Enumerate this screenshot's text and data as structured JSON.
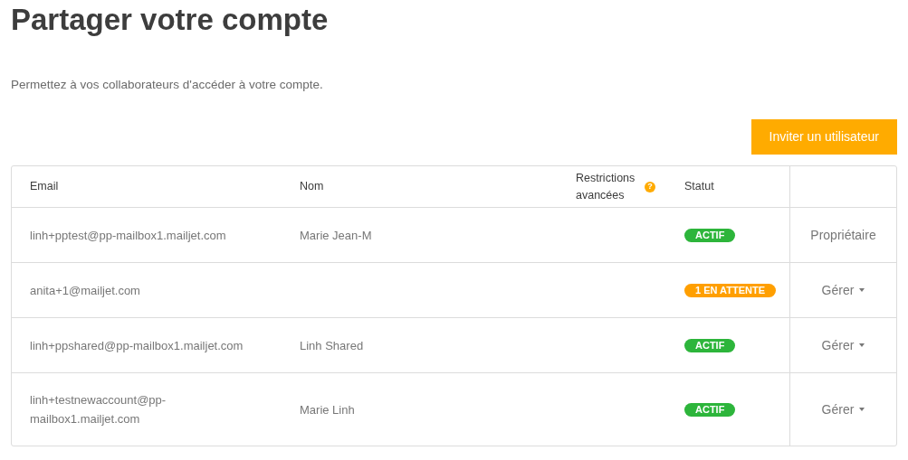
{
  "title": "Partager votre compte",
  "subtitle": "Permettez à vos collaborateurs d'accéder à votre compte.",
  "invite_button": "Inviter un utilisateur",
  "table": {
    "columns": [
      {
        "label": "Email"
      },
      {
        "label": "Nom"
      },
      {
        "label": "Restrictions avancées",
        "help": "?"
      },
      {
        "label": "Statut"
      }
    ],
    "rows": [
      {
        "email": "linh+pptest@pp-mailbox1.mailjet.com",
        "name": "Marie Jean-M",
        "status": {
          "kind": "active",
          "label": "ACTIF"
        },
        "action": {
          "kind": "owner",
          "label": "Propriétaire"
        }
      },
      {
        "email": "anita+1@mailjet.com",
        "status": {
          "kind": "pending",
          "label": "1 EN ATTENTE"
        },
        "action": {
          "kind": "manage",
          "label": "Gérer"
        }
      },
      {
        "email": "linh+ppshared@pp-mailbox1.mailjet.com",
        "name": "Linh Shared",
        "status": {
          "kind": "active",
          "label": "ACTIF"
        },
        "action": {
          "kind": "manage",
          "label": "Gérer"
        }
      },
      {
        "email": "linh+testnewaccount@pp-mailbox1.mailjet.com",
        "name": "Marie Linh",
        "status": {
          "kind": "active",
          "label": "ACTIF"
        },
        "action": {
          "kind": "manage",
          "label": "Gérer"
        }
      }
    ]
  }
}
